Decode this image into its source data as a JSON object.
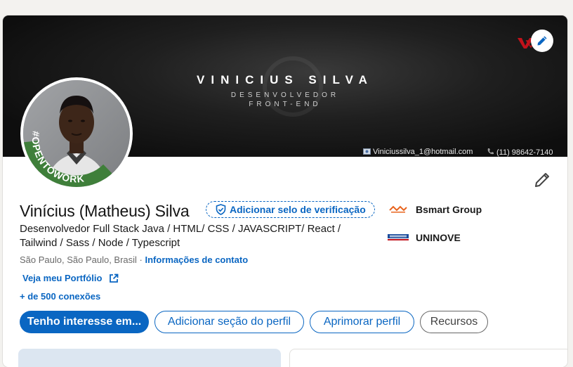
{
  "banner": {
    "title": "VINICIUS SILVA",
    "subtitle_line1": "DESENVOLVEDOR",
    "subtitle_line2": "FRONT-END",
    "email": "Viniciussilva_1@hotmail.com",
    "phone": "(11) 98642-7140",
    "brand_mark": "V"
  },
  "avatar": {
    "badge_text": "#OPENTOWORK"
  },
  "profile": {
    "name": "Vinícius (Matheus) Silva",
    "verify_label": "Adicionar selo de verificação",
    "headline": "Desenvolvedor Full Stack Java / HTML/ CSS / JAVASCRIPT/ React / Tailwind / Sass / Node / Typescript",
    "location": "São Paulo, São Paulo, Brasil",
    "location_separator": " · ",
    "contact_info_label": "Informações de contato",
    "portfolio_label": "Veja meu Portfólio",
    "connections_label": "+ de 500 conexões"
  },
  "companies": [
    {
      "name": "Bsmart Group",
      "logo": "bsmart-logo"
    },
    {
      "name": "UNINOVE",
      "logo": "uninove-logo"
    }
  ],
  "actions": {
    "open_to": "Tenho interesse em...",
    "add_section": "Adicionar seção do perfil",
    "enhance": "Aprimorar perfil",
    "resources": "Recursos"
  },
  "colors": {
    "primary": "#0a66c2",
    "open_to_work_green": "#3f7f3a",
    "brand_red": "#c0121b"
  }
}
